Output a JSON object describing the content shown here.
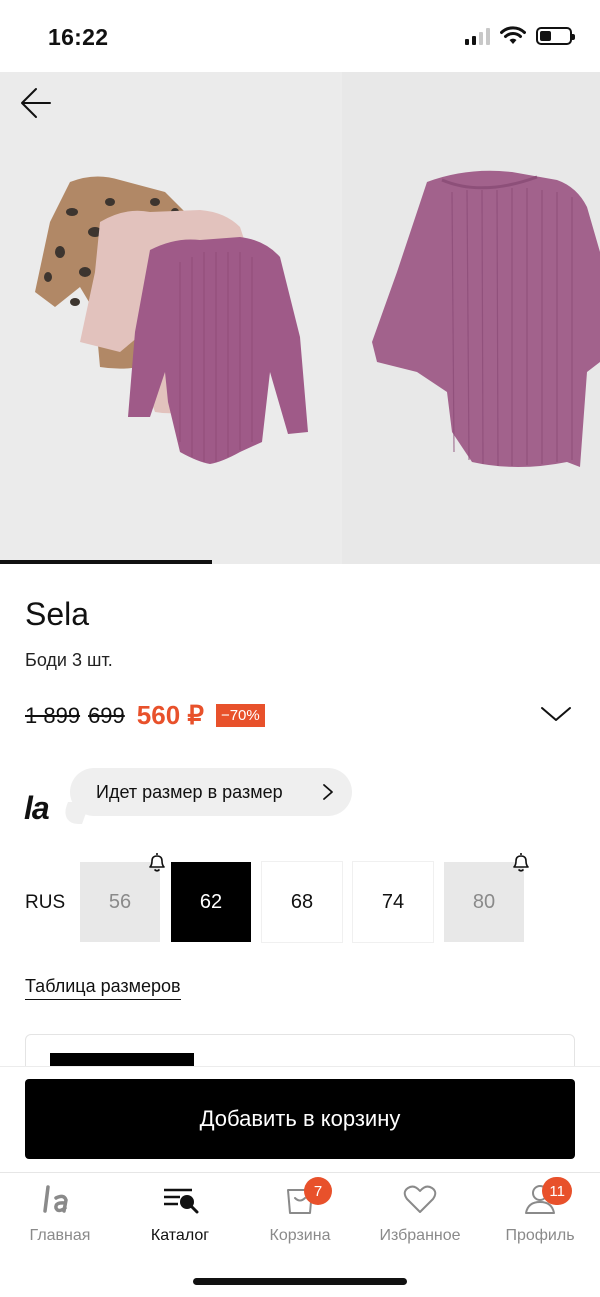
{
  "status_bar": {
    "time": "16:22",
    "battery_level": 0.4
  },
  "product": {
    "brand": "Sela",
    "name": "Боди 3 шт.",
    "price_original": "1 899",
    "price_previous": "699",
    "price_current": "560 ₽",
    "discount": "−70%"
  },
  "fit_hint": {
    "logo": "la",
    "text": "Идет размер в размер"
  },
  "sizes": {
    "system": "RUS",
    "options": [
      {
        "label": "56",
        "state": "unavailable",
        "notify": true
      },
      {
        "label": "62",
        "state": "selected",
        "notify": false
      },
      {
        "label": "68",
        "state": "available",
        "notify": false
      },
      {
        "label": "74",
        "state": "available",
        "notify": false
      },
      {
        "label": "80",
        "state": "unavailable",
        "notify": true
      }
    ],
    "table_link": "Таблица размеров"
  },
  "cart": {
    "button_label": "Добавить в корзину"
  },
  "tabs": [
    {
      "label": "Главная",
      "icon": "la-logo-icon",
      "badge": ""
    },
    {
      "label": "Каталог",
      "icon": "catalog-search-icon",
      "badge": ""
    },
    {
      "label": "Корзина",
      "icon": "shopping-bag-icon",
      "badge": "7"
    },
    {
      "label": "Избранное",
      "icon": "heart-icon",
      "badge": ""
    },
    {
      "label": "Профиль",
      "icon": "profile-icon",
      "badge": "11"
    }
  ],
  "colors": {
    "accent": "#e8512b",
    "primary": "#000000",
    "muted": "#8a8a8a",
    "unavailable_bg": "#e8e8e8"
  }
}
